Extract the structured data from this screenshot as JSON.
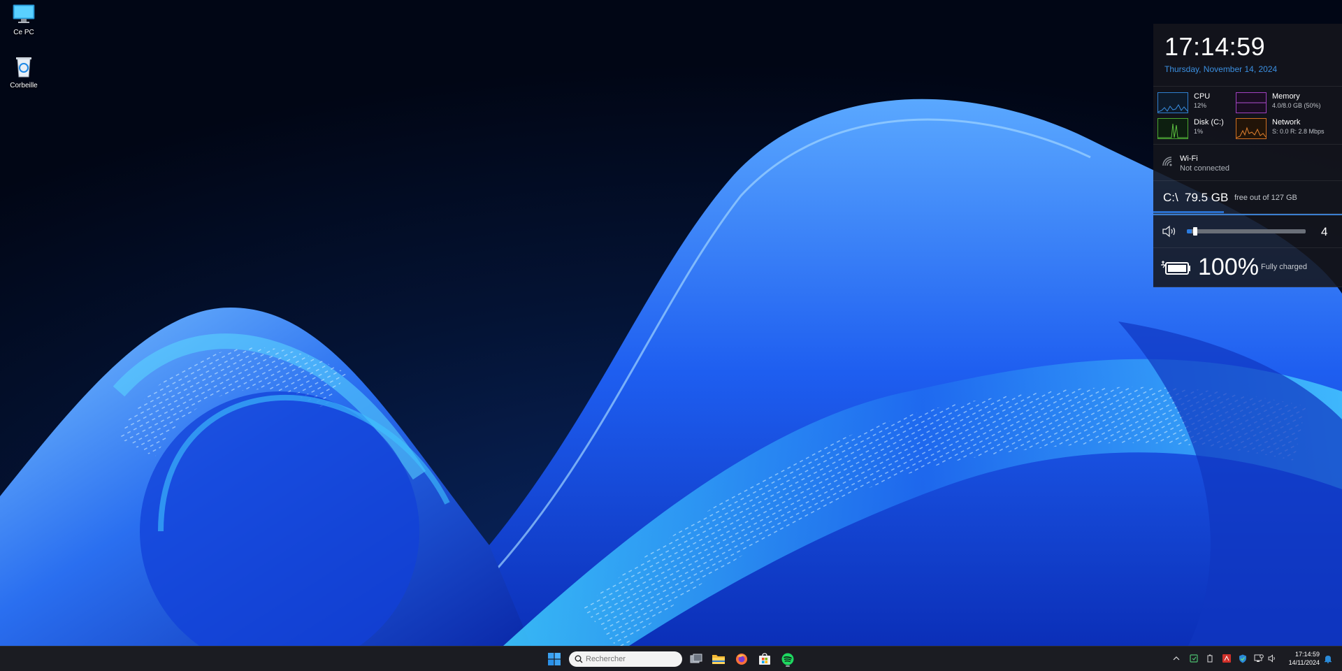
{
  "desktop": {
    "icons": [
      {
        "label": "Ce PC",
        "icon": "monitor-icon"
      },
      {
        "label": "Corbeille",
        "icon": "recycle-bin-icon"
      }
    ]
  },
  "widgets": {
    "clock": {
      "time": "17:14:59",
      "date": "Thursday, November 14, 2024",
      "date_color": "#3b8fe0"
    },
    "system": [
      {
        "name": "CPU",
        "value": "12%",
        "color": "#2f7fd0"
      },
      {
        "name": "Memory",
        "value": "4.0/8.0 GB (50%)",
        "color": "#a040c0"
      },
      {
        "name": "Disk (C:)",
        "value": "1%",
        "color": "#4aa830"
      },
      {
        "name": "Network",
        "value": "S: 0.0 R: 2.8 Mbps",
        "color": "#d07020"
      }
    ],
    "wifi": {
      "name": "Wi-Fi",
      "status": "Not connected"
    },
    "disk": {
      "drive": "C:\\",
      "free": "79.5 GB",
      "desc": "free out of 127 GB",
      "used_fraction": 0.374
    },
    "volume": {
      "level": 4
    },
    "battery": {
      "percent": "100%",
      "status": "Fully charged"
    }
  },
  "taskbar": {
    "search_placeholder": "Rechercher",
    "apps": [
      "start-icon",
      "task-view-icon",
      "file-explorer-icon",
      "firefox-icon",
      "microsoft-store-icon",
      "spotify-icon"
    ],
    "clock": {
      "time": "17:14:59",
      "date": "14/11/2024"
    }
  },
  "colors": {
    "accent": "#2a7be0",
    "taskbar": "#1b1c22"
  }
}
